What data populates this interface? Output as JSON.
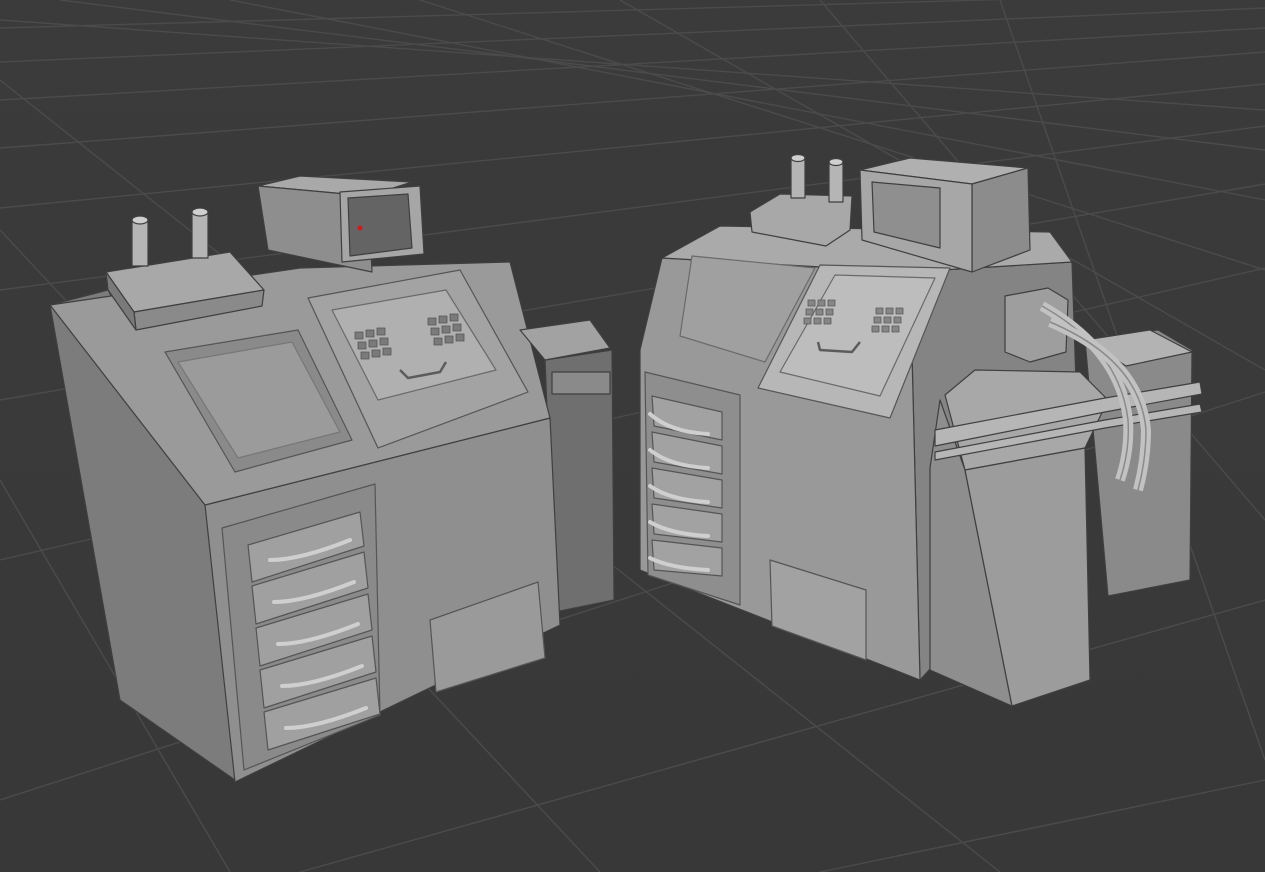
{
  "scene": {
    "models": [
      {
        "name": "console-left"
      },
      {
        "name": "console-right"
      }
    ],
    "indicator_color": "#d11a1a",
    "background_color": "#3a3a3a",
    "grid_color": "#4a4a4a",
    "material_color": "#8a8a8a"
  }
}
